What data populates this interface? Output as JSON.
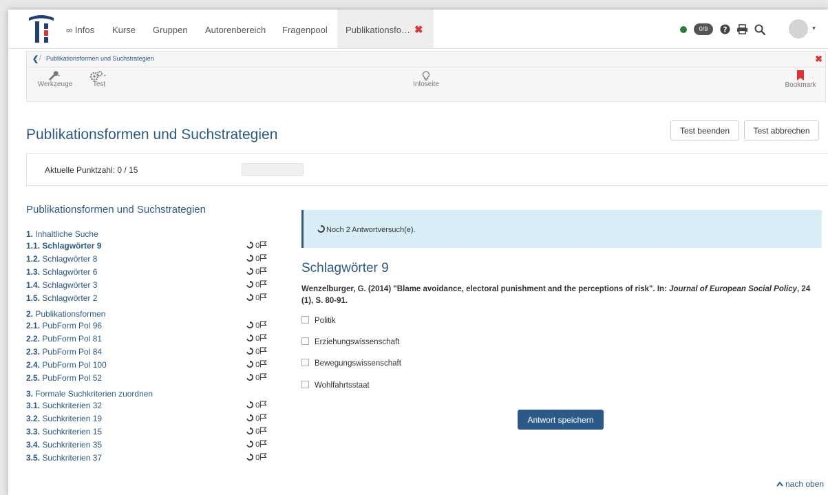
{
  "nav": {
    "items": [
      "∞ Infos",
      "Kurse",
      "Gruppen",
      "Autorenbereich",
      "Fragenpool"
    ],
    "active_tab": "Publikationsfo…",
    "close_glyph": "✖",
    "badge": "0/9"
  },
  "toolbar": {
    "back_glyph": "❮",
    "breadcrumb": "Publikationsformen und Suchstrategien",
    "close_glyph": "✖",
    "tools": [
      {
        "label": "Werkzeuge",
        "icon": "wrench-icon"
      },
      {
        "label": "Test",
        "icon": "gears-icon"
      },
      {
        "label": "Infoseite",
        "icon": "lightbulb-icon"
      },
      {
        "label": "Bookmark",
        "icon": "bookmark-icon"
      }
    ]
  },
  "page": {
    "title": "Publikationsformen und Suchstrategien",
    "end_button": "Test beenden",
    "cancel_button": "Test abbrechen",
    "score_label": "Aktuelle Punktzahl: 0 / 15",
    "score_fraction": 0
  },
  "menu": {
    "title": "Publikationsformen und Suchstrategien",
    "sections": [
      {
        "num": "1.",
        "title": "Inhaltliche Suche",
        "items": [
          {
            "num": "1.1.",
            "label": "Schlagwörter 9",
            "count": "0",
            "active": true
          },
          {
            "num": "1.2.",
            "label": "Schlagwörter 8",
            "count": "0"
          },
          {
            "num": "1.3.",
            "label": "Schlagwörter 6",
            "count": "0"
          },
          {
            "num": "1.4.",
            "label": "Schlagwörter 3",
            "count": "0"
          },
          {
            "num": "1.5.",
            "label": "Schlagwörter 2",
            "count": "0"
          }
        ]
      },
      {
        "num": "2.",
        "title": "Publikationsformen",
        "items": [
          {
            "num": "2.1.",
            "label": "PubForm Pol 96",
            "count": "0"
          },
          {
            "num": "2.2.",
            "label": "PubForm Pol 81",
            "count": "0"
          },
          {
            "num": "2.3.",
            "label": "PubForm Pol 84",
            "count": "0"
          },
          {
            "num": "2.4.",
            "label": "PubForm Pol 100",
            "count": "0"
          },
          {
            "num": "2.5.",
            "label": "PubForm Pol 52",
            "count": "0"
          }
        ]
      },
      {
        "num": "3.",
        "title": "Formale Suchkriterien zuordnen",
        "items": [
          {
            "num": "3.1.",
            "label": "Suchkriterien 32",
            "count": "0"
          },
          {
            "num": "3.2.",
            "label": "Suchkriterien 19",
            "count": "0"
          },
          {
            "num": "3.3.",
            "label": "Suchkriterien 15",
            "count": "0"
          },
          {
            "num": "3.4.",
            "label": "Suchkriterien 35",
            "count": "0"
          },
          {
            "num": "3.5.",
            "label": "Suchkriterien 37",
            "count": "0"
          }
        ]
      }
    ]
  },
  "question": {
    "attempts": "Noch 2 Antwortversuch(e).",
    "title": "Schlagwörter 9",
    "text_plain": "Wenzelburger, G. (2014) \"Blame avoidance, electoral punishment and the perceptions of risk\". In: ",
    "text_italic": "Journal of European Social Policy",
    "text_tail": ", 24 (1), S. 80-91.",
    "options": [
      "Politik",
      "Erziehungswissenschaft",
      "Bewegungswissenschaft",
      "Wohlfahrtsstaat"
    ],
    "save_button": "Antwort speichern"
  },
  "footer": {
    "to_top": "nach oben"
  },
  "colors": {
    "accent": "#2b5a88",
    "danger": "#dd3333",
    "info_bg": "#d9edf7",
    "status_green": "#2a7d3e"
  }
}
